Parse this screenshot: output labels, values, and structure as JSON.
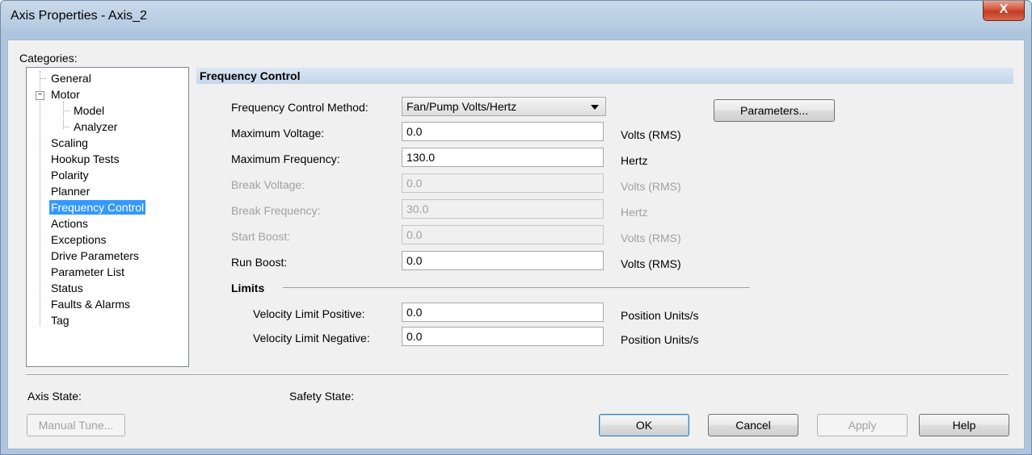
{
  "window": {
    "title": "Axis Properties - Axis_2",
    "close_glyph": "X"
  },
  "categories": {
    "label": "Categories:",
    "items": [
      {
        "label": "General"
      },
      {
        "label": "Motor"
      },
      {
        "label": "Model"
      },
      {
        "label": "Analyzer"
      },
      {
        "label": "Scaling"
      },
      {
        "label": "Hookup Tests"
      },
      {
        "label": "Polarity"
      },
      {
        "label": "Planner"
      },
      {
        "label": "Frequency Control"
      },
      {
        "label": "Actions"
      },
      {
        "label": "Exceptions"
      },
      {
        "label": "Drive Parameters"
      },
      {
        "label": "Parameter List"
      },
      {
        "label": "Status"
      },
      {
        "label": "Faults & Alarms"
      },
      {
        "label": "Tag"
      }
    ],
    "selected": "Frequency Control",
    "expander_glyph": "−"
  },
  "section": {
    "title": "Frequency Control"
  },
  "form": {
    "method": {
      "label": "Frequency Control Method:",
      "value": "Fan/Pump Volts/Hertz"
    },
    "parameters_button": "Parameters...",
    "max_voltage": {
      "label": "Maximum Voltage:",
      "value": "0.0",
      "unit": "Volts (RMS)"
    },
    "max_frequency": {
      "label": "Maximum Frequency:",
      "value": "130.0",
      "unit": "Hertz"
    },
    "break_voltage": {
      "label": "Break Voltage:",
      "value": "0.0",
      "unit": "Volts (RMS)",
      "enabled": false
    },
    "break_frequency": {
      "label": "Break Frequency:",
      "value": "30.0",
      "unit": "Hertz",
      "enabled": false
    },
    "start_boost": {
      "label": "Start Boost:",
      "value": "0.0",
      "unit": "Volts (RMS)",
      "enabled": false
    },
    "run_boost": {
      "label": "Run Boost:",
      "value": "0.0",
      "unit": "Volts (RMS)"
    },
    "limits": {
      "title": "Limits",
      "vel_pos": {
        "label": "Velocity Limit Positive:",
        "value": "0.0",
        "unit": "Position Units/s"
      },
      "vel_neg": {
        "label": "Velocity Limit Negative:",
        "value": "0.0",
        "unit": "Position Units/s"
      }
    }
  },
  "footer": {
    "axis_state": "Axis State:",
    "safety_state": "Safety State:",
    "manual_tune": "Manual Tune...",
    "ok": "OK",
    "cancel": "Cancel",
    "apply": "Apply",
    "help": "Help"
  }
}
